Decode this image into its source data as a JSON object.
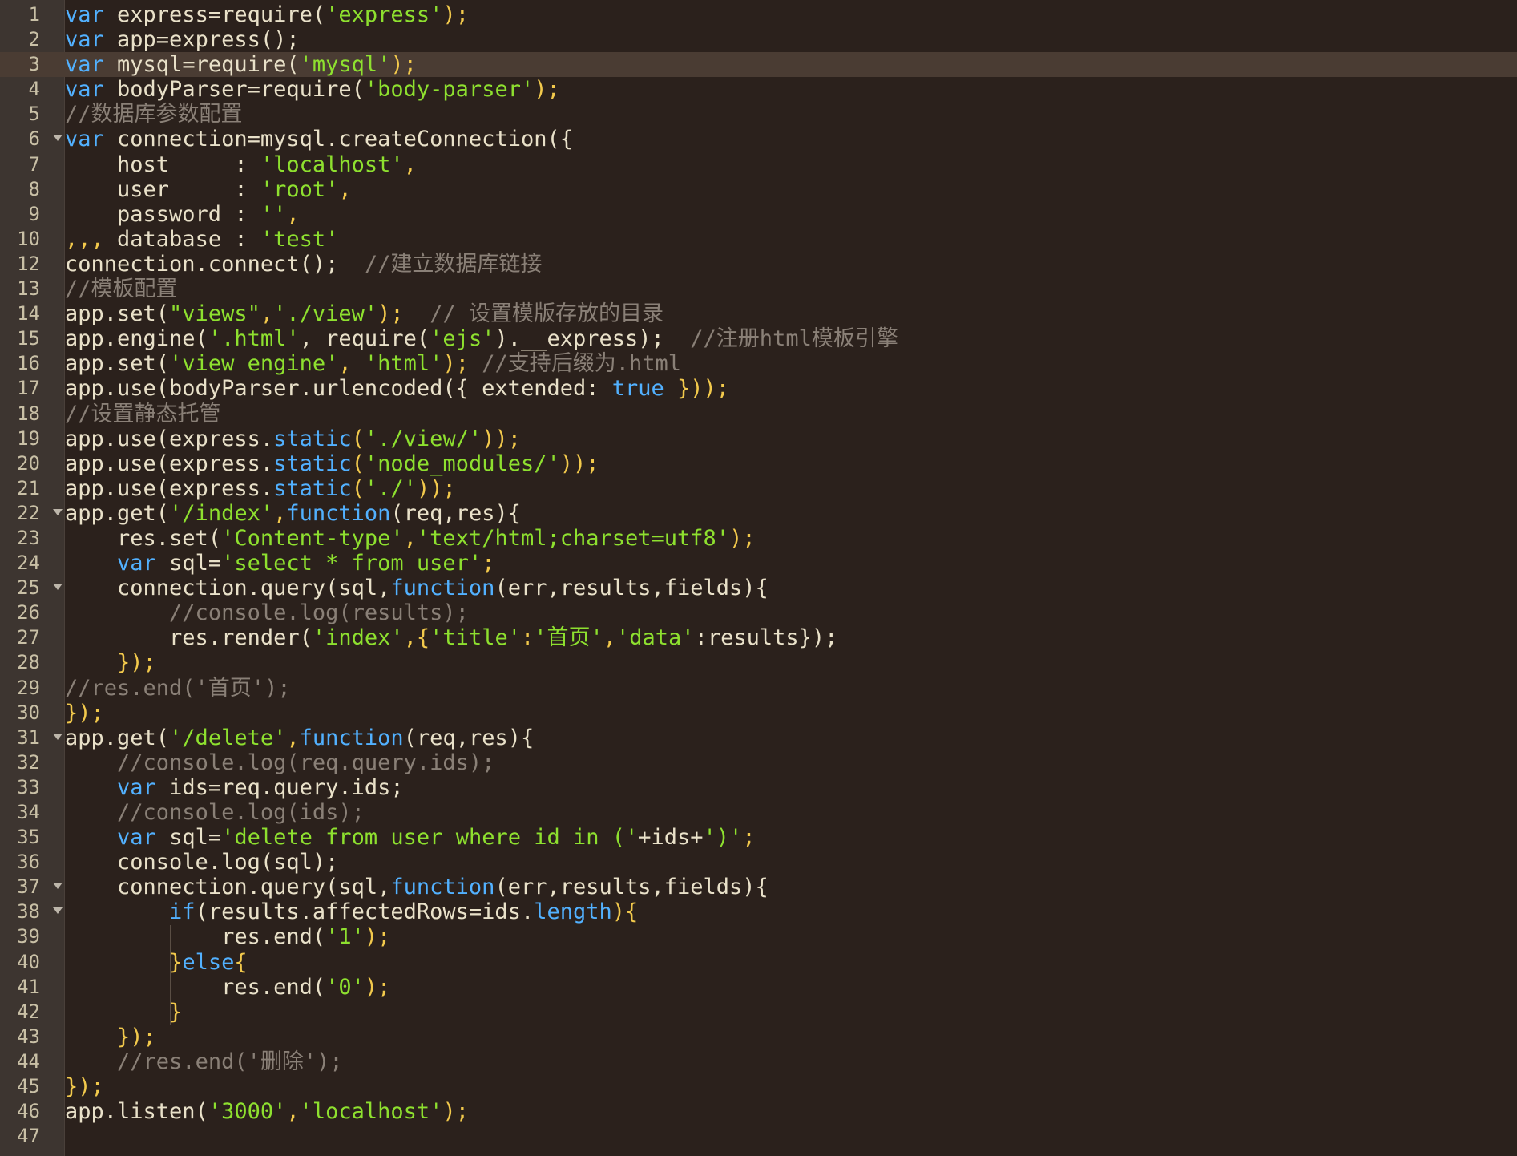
{
  "editor": {
    "current_line": 3,
    "colors": {
      "background": "#2b211c",
      "gutter": "#3d3530",
      "current_line": "#4a3c33",
      "keyword": "#52b1ff",
      "string": "#8ee02f",
      "comment": "#8a8077",
      "identifier": "#e9e1c9",
      "punctuation": "#f2c94c",
      "line_number": "#c9c0a6"
    },
    "lines": [
      {
        "n": "1",
        "fold": false,
        "tokens": [
          {
            "t": "var",
            "c": "kw"
          },
          {
            "t": " express=require(",
            "c": "id"
          },
          {
            "t": "'express'",
            "c": "str"
          },
          {
            "t": ");",
            "c": "pun"
          }
        ]
      },
      {
        "n": "2",
        "fold": false,
        "tokens": [
          {
            "t": "var",
            "c": "kw"
          },
          {
            "t": " app=express();",
            "c": "id"
          }
        ]
      },
      {
        "n": "3",
        "fold": false,
        "tokens": [
          {
            "t": "var",
            "c": "kw"
          },
          {
            "t": " mysql=require(",
            "c": "id"
          },
          {
            "t": "'mysql'",
            "c": "str"
          },
          {
            "t": ");",
            "c": "pun"
          }
        ]
      },
      {
        "n": "4",
        "fold": false,
        "tokens": [
          {
            "t": "var",
            "c": "kw"
          },
          {
            "t": " bodyParser=require(",
            "c": "id"
          },
          {
            "t": "'body-parser'",
            "c": "str"
          },
          {
            "t": ");",
            "c": "pun"
          }
        ]
      },
      {
        "n": "5",
        "fold": false,
        "tokens": [
          {
            "t": "//数据库参数配置",
            "c": "com"
          }
        ]
      },
      {
        "n": "6",
        "fold": true,
        "tokens": [
          {
            "t": "var",
            "c": "kw"
          },
          {
            "t": " connection=mysql.createConnection({",
            "c": "id"
          }
        ]
      },
      {
        "n": "7",
        "fold": false,
        "tokens": [
          {
            "t": "    host     : ",
            "c": "id"
          },
          {
            "t": "'localhost'",
            "c": "str"
          },
          {
            "t": ",",
            "c": "pun"
          }
        ]
      },
      {
        "n": "8",
        "fold": false,
        "tokens": [
          {
            "t": "    user     : ",
            "c": "id"
          },
          {
            "t": "'root'",
            "c": "str"
          },
          {
            "t": ",",
            "c": "pun"
          }
        ]
      },
      {
        "n": "9",
        "fold": false,
        "tokens": [
          {
            "t": "    password : ",
            "c": "id"
          },
          {
            "t": "''",
            "c": "str"
          },
          {
            "t": ",",
            "c": "pun"
          }
        ]
      },
      {
        "n": "10",
        "fold": false,
        "tokens": [
          {
            "t": ",,, ",
            "c": "pun"
          },
          {
            "t": "database : ",
            "c": "id"
          },
          {
            "t": "'test'",
            "c": "str"
          }
        ]
      },
      {
        "n": "12",
        "fold": false,
        "tokens": [
          {
            "t": "connection.connect();  ",
            "c": "id"
          },
          {
            "t": "//建立数据库链接",
            "c": "com"
          }
        ]
      },
      {
        "n": "13",
        "fold": false,
        "tokens": [
          {
            "t": "//模板配置",
            "c": "com"
          }
        ]
      },
      {
        "n": "14",
        "fold": false,
        "tokens": [
          {
            "t": "app.set(",
            "c": "id"
          },
          {
            "t": "\"views\"",
            "c": "str"
          },
          {
            "t": ",",
            "c": "pun"
          },
          {
            "t": "'./view'",
            "c": "str"
          },
          {
            "t": ");  ",
            "c": "pun"
          },
          {
            "t": "// 设置模版存放的目录",
            "c": "com"
          }
        ]
      },
      {
        "n": "15",
        "fold": false,
        "tokens": [
          {
            "t": "app.engine(",
            "c": "id"
          },
          {
            "t": "'.html'",
            "c": "str"
          },
          {
            "t": ", require(",
            "c": "id"
          },
          {
            "t": "'ejs'",
            "c": "str"
          },
          {
            "t": ").__express);  ",
            "c": "id"
          },
          {
            "t": "//注册html模板引擎",
            "c": "com"
          }
        ]
      },
      {
        "n": "16",
        "fold": false,
        "tokens": [
          {
            "t": "app.set(",
            "c": "id"
          },
          {
            "t": "'view engine'",
            "c": "str"
          },
          {
            "t": ", ",
            "c": "pun"
          },
          {
            "t": "'html'",
            "c": "str"
          },
          {
            "t": "); ",
            "c": "pun"
          },
          {
            "t": "//支持后缀为.html",
            "c": "com"
          }
        ]
      },
      {
        "n": "17",
        "fold": false,
        "tokens": [
          {
            "t": "app.use(bodyParser.urlencoded({ extended: ",
            "c": "id"
          },
          {
            "t": "true",
            "c": "kw"
          },
          {
            "t": " }));",
            "c": "pun"
          }
        ]
      },
      {
        "n": "18",
        "fold": false,
        "tokens": [
          {
            "t": "//设置静态托管",
            "c": "com"
          }
        ]
      },
      {
        "n": "19",
        "fold": false,
        "tokens": [
          {
            "t": "app.use(express.",
            "c": "id"
          },
          {
            "t": "static",
            "c": "kw"
          },
          {
            "t": "(",
            "c": "pun"
          },
          {
            "t": "'./view/'",
            "c": "str"
          },
          {
            "t": "));",
            "c": "pun"
          }
        ]
      },
      {
        "n": "20",
        "fold": false,
        "tokens": [
          {
            "t": "app.use(express.",
            "c": "id"
          },
          {
            "t": "static",
            "c": "kw"
          },
          {
            "t": "(",
            "c": "pun"
          },
          {
            "t": "'node_modules/'",
            "c": "str"
          },
          {
            "t": "));",
            "c": "pun"
          }
        ]
      },
      {
        "n": "21",
        "fold": false,
        "tokens": [
          {
            "t": "app.use(express.",
            "c": "id"
          },
          {
            "t": "static",
            "c": "kw"
          },
          {
            "t": "(",
            "c": "pun"
          },
          {
            "t": "'./'",
            "c": "str"
          },
          {
            "t": "));",
            "c": "pun"
          }
        ]
      },
      {
        "n": "22",
        "fold": true,
        "tokens": [
          {
            "t": "app.get(",
            "c": "id"
          },
          {
            "t": "'/index'",
            "c": "str"
          },
          {
            "t": ",",
            "c": "pun"
          },
          {
            "t": "function",
            "c": "kw"
          },
          {
            "t": "(req,res){",
            "c": "id"
          }
        ]
      },
      {
        "n": "23",
        "fold": false,
        "tokens": [
          {
            "t": "    res.set(",
            "c": "id"
          },
          {
            "t": "'Content-type'",
            "c": "str"
          },
          {
            "t": ",",
            "c": "pun"
          },
          {
            "t": "'text/html;charset=utf8'",
            "c": "str"
          },
          {
            "t": ");",
            "c": "pun"
          }
        ]
      },
      {
        "n": "24",
        "fold": false,
        "tokens": [
          {
            "t": "    ",
            "c": "id"
          },
          {
            "t": "var",
            "c": "kw"
          },
          {
            "t": " sql=",
            "c": "id"
          },
          {
            "t": "'select * from user'",
            "c": "str"
          },
          {
            "t": ";",
            "c": "pun"
          }
        ]
      },
      {
        "n": "25",
        "fold": true,
        "tokens": [
          {
            "t": "    connection.query(sql,",
            "c": "id"
          },
          {
            "t": "function",
            "c": "kw"
          },
          {
            "t": "(err,results,fields){",
            "c": "id"
          }
        ]
      },
      {
        "n": "26",
        "fold": false,
        "tokens": [
          {
            "t": "        ",
            "c": "id"
          },
          {
            "t": "//console.log(results);",
            "c": "com"
          }
        ]
      },
      {
        "n": "27",
        "fold": false,
        "tokens": [
          {
            "t": "        res.render(",
            "c": "id"
          },
          {
            "t": "'index'",
            "c": "str"
          },
          {
            "t": ",{",
            "c": "pun"
          },
          {
            "t": "'title'",
            "c": "str"
          },
          {
            "t": ":",
            "c": "pun"
          },
          {
            "t": "'首页'",
            "c": "str"
          },
          {
            "t": ",",
            "c": "pun"
          },
          {
            "t": "'data'",
            "c": "str"
          },
          {
            "t": ":results});",
            "c": "id"
          }
        ]
      },
      {
        "n": "28",
        "fold": false,
        "tokens": [
          {
            "t": "    });",
            "c": "pun"
          }
        ]
      },
      {
        "n": "29",
        "fold": false,
        "tokens": [
          {
            "t": "//res.end('首页');",
            "c": "com"
          }
        ]
      },
      {
        "n": "30",
        "fold": false,
        "tokens": [
          {
            "t": "});",
            "c": "pun"
          }
        ]
      },
      {
        "n": "31",
        "fold": true,
        "tokens": [
          {
            "t": "app.get(",
            "c": "id"
          },
          {
            "t": "'/delete'",
            "c": "str"
          },
          {
            "t": ",",
            "c": "pun"
          },
          {
            "t": "function",
            "c": "kw"
          },
          {
            "t": "(req,res){",
            "c": "id"
          }
        ]
      },
      {
        "n": "32",
        "fold": false,
        "tokens": [
          {
            "t": "    ",
            "c": "id"
          },
          {
            "t": "//console.log(req.query.ids);",
            "c": "com"
          }
        ]
      },
      {
        "n": "33",
        "fold": false,
        "tokens": [
          {
            "t": "    ",
            "c": "id"
          },
          {
            "t": "var",
            "c": "kw"
          },
          {
            "t": " ids=req.query.ids;",
            "c": "id"
          }
        ]
      },
      {
        "n": "34",
        "fold": false,
        "tokens": [
          {
            "t": "    ",
            "c": "id"
          },
          {
            "t": "//console.log(ids);",
            "c": "com"
          }
        ]
      },
      {
        "n": "35",
        "fold": false,
        "tokens": [
          {
            "t": "    ",
            "c": "id"
          },
          {
            "t": "var",
            "c": "kw"
          },
          {
            "t": " sql=",
            "c": "id"
          },
          {
            "t": "'delete from user where id in ('",
            "c": "str"
          },
          {
            "t": "+ids+",
            "c": "id"
          },
          {
            "t": "')'",
            "c": "str"
          },
          {
            "t": ";",
            "c": "pun"
          }
        ]
      },
      {
        "n": "36",
        "fold": false,
        "tokens": [
          {
            "t": "    console.log(sql);",
            "c": "id"
          }
        ]
      },
      {
        "n": "37",
        "fold": true,
        "tokens": [
          {
            "t": "    connection.query(sql,",
            "c": "id"
          },
          {
            "t": "function",
            "c": "kw"
          },
          {
            "t": "(err,results,fields){",
            "c": "id"
          }
        ]
      },
      {
        "n": "38",
        "fold": true,
        "tokens": [
          {
            "t": "        ",
            "c": "id"
          },
          {
            "t": "if",
            "c": "kw"
          },
          {
            "t": "(results.affectedRows=ids.",
            "c": "id"
          },
          {
            "t": "length",
            "c": "kw"
          },
          {
            "t": "){",
            "c": "pun"
          }
        ]
      },
      {
        "n": "39",
        "fold": false,
        "tokens": [
          {
            "t": "            res.end(",
            "c": "id"
          },
          {
            "t": "'1'",
            "c": "str"
          },
          {
            "t": ");",
            "c": "pun"
          }
        ]
      },
      {
        "n": "40",
        "fold": false,
        "tokens": [
          {
            "t": "        }",
            "c": "pun"
          },
          {
            "t": "else",
            "c": "kw"
          },
          {
            "t": "{",
            "c": "pun"
          }
        ]
      },
      {
        "n": "41",
        "fold": false,
        "tokens": [
          {
            "t": "            res.end(",
            "c": "id"
          },
          {
            "t": "'0'",
            "c": "str"
          },
          {
            "t": ");",
            "c": "pun"
          }
        ]
      },
      {
        "n": "42",
        "fold": false,
        "tokens": [
          {
            "t": "        }",
            "c": "pun"
          }
        ]
      },
      {
        "n": "43",
        "fold": false,
        "tokens": [
          {
            "t": "    });",
            "c": "pun"
          }
        ]
      },
      {
        "n": "44",
        "fold": false,
        "tokens": [
          {
            "t": "    ",
            "c": "id"
          },
          {
            "t": "//res.end('删除');",
            "c": "com"
          }
        ]
      },
      {
        "n": "45",
        "fold": false,
        "tokens": [
          {
            "t": "});",
            "c": "pun"
          }
        ]
      },
      {
        "n": "46",
        "fold": false,
        "tokens": [
          {
            "t": "app.listen(",
            "c": "id"
          },
          {
            "t": "'3000'",
            "c": "str"
          },
          {
            "t": ",",
            "c": "pun"
          },
          {
            "t": "'localhost'",
            "c": "str"
          },
          {
            "t": ");",
            "c": "pun"
          }
        ]
      },
      {
        "n": "47",
        "fold": false,
        "tokens": []
      }
    ]
  }
}
